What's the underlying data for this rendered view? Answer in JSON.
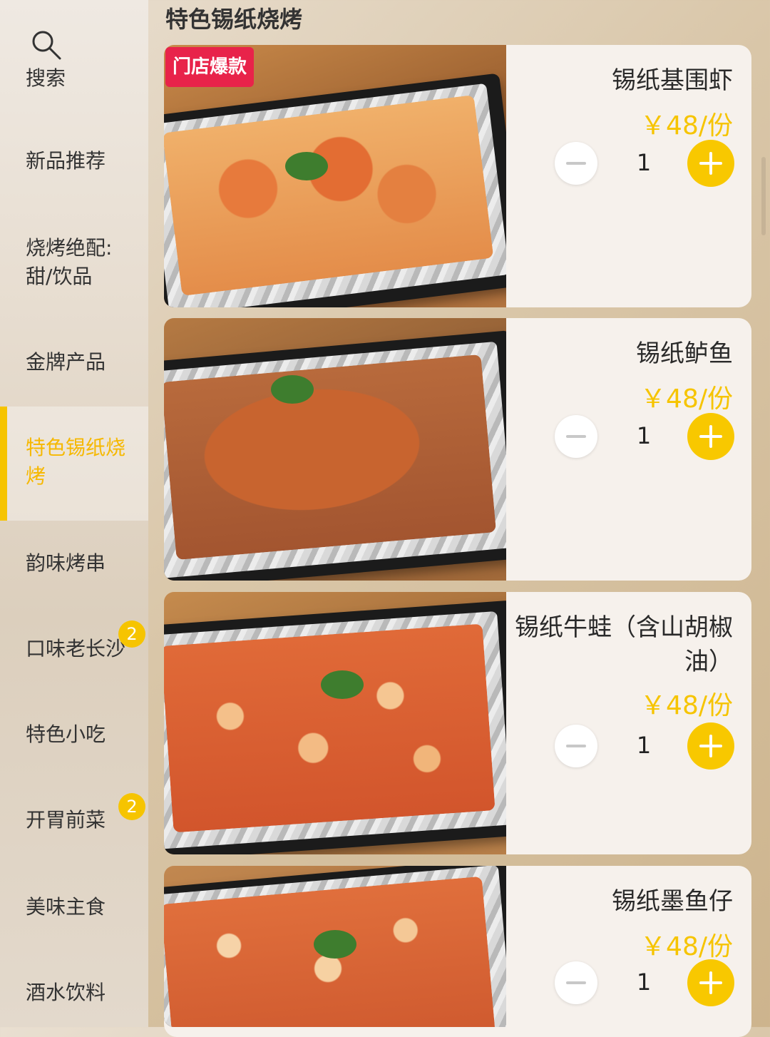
{
  "search": {
    "label": "搜索"
  },
  "sidebar": {
    "items": [
      {
        "label": "新品推荐",
        "badge": ""
      },
      {
        "label": "烧烤绝配:甜/饮品",
        "badge": ""
      },
      {
        "label": "金牌产品",
        "badge": ""
      },
      {
        "label": "特色锡纸烧烤",
        "badge": ""
      },
      {
        "label": "韵味烤串",
        "badge": ""
      },
      {
        "label": "口味老长沙",
        "badge": "2"
      },
      {
        "label": "特色小吃",
        "badge": ""
      },
      {
        "label": "开胃前菜",
        "badge": "2"
      },
      {
        "label": "美味主食",
        "badge": ""
      },
      {
        "label": "酒水饮料",
        "badge": ""
      }
    ],
    "active_index": 3
  },
  "section": {
    "title": "特色锡纸烧烤"
  },
  "hot_tag": "门店爆款",
  "products": [
    {
      "name": "锡纸基围虾",
      "price": "￥48/份",
      "qty": "1"
    },
    {
      "name": "锡纸鲈鱼",
      "price": "￥48/份",
      "qty": "1"
    },
    {
      "name": "锡纸牛蛙（含山胡椒油）",
      "price": "￥48/份",
      "qty": "1"
    },
    {
      "name": "锡纸墨鱼仔",
      "price": "￥48/份",
      "qty": "1"
    }
  ],
  "colors": {
    "accent": "#f6c400",
    "hot_tag": "#e8234a"
  },
  "icons": [
    "search-icon",
    "minus-icon",
    "plus-icon"
  ]
}
